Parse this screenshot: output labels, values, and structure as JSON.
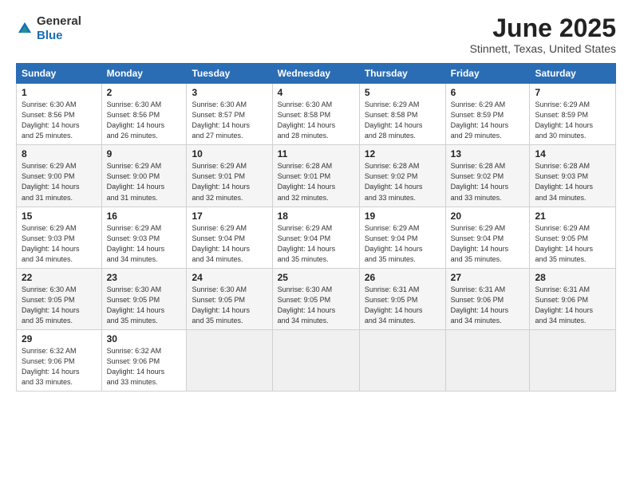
{
  "logo": {
    "general": "General",
    "blue": "Blue"
  },
  "title": "June 2025",
  "subtitle": "Stinnett, Texas, United States",
  "weekdays": [
    "Sunday",
    "Monday",
    "Tuesday",
    "Wednesday",
    "Thursday",
    "Friday",
    "Saturday"
  ],
  "weeks": [
    [
      {
        "day": "1",
        "sunrise": "6:30 AM",
        "sunset": "8:56 PM",
        "daylight": "14 hours and 25 minutes."
      },
      {
        "day": "2",
        "sunrise": "6:30 AM",
        "sunset": "8:56 PM",
        "daylight": "14 hours and 26 minutes."
      },
      {
        "day": "3",
        "sunrise": "6:30 AM",
        "sunset": "8:57 PM",
        "daylight": "14 hours and 27 minutes."
      },
      {
        "day": "4",
        "sunrise": "6:30 AM",
        "sunset": "8:58 PM",
        "daylight": "14 hours and 28 minutes."
      },
      {
        "day": "5",
        "sunrise": "6:29 AM",
        "sunset": "8:58 PM",
        "daylight": "14 hours and 28 minutes."
      },
      {
        "day": "6",
        "sunrise": "6:29 AM",
        "sunset": "8:59 PM",
        "daylight": "14 hours and 29 minutes."
      },
      {
        "day": "7",
        "sunrise": "6:29 AM",
        "sunset": "8:59 PM",
        "daylight": "14 hours and 30 minutes."
      }
    ],
    [
      {
        "day": "8",
        "sunrise": "6:29 AM",
        "sunset": "9:00 PM",
        "daylight": "14 hours and 31 minutes."
      },
      {
        "day": "9",
        "sunrise": "6:29 AM",
        "sunset": "9:00 PM",
        "daylight": "14 hours and 31 minutes."
      },
      {
        "day": "10",
        "sunrise": "6:29 AM",
        "sunset": "9:01 PM",
        "daylight": "14 hours and 32 minutes."
      },
      {
        "day": "11",
        "sunrise": "6:28 AM",
        "sunset": "9:01 PM",
        "daylight": "14 hours and 32 minutes."
      },
      {
        "day": "12",
        "sunrise": "6:28 AM",
        "sunset": "9:02 PM",
        "daylight": "14 hours and 33 minutes."
      },
      {
        "day": "13",
        "sunrise": "6:28 AM",
        "sunset": "9:02 PM",
        "daylight": "14 hours and 33 minutes."
      },
      {
        "day": "14",
        "sunrise": "6:28 AM",
        "sunset": "9:03 PM",
        "daylight": "14 hours and 34 minutes."
      }
    ],
    [
      {
        "day": "15",
        "sunrise": "6:29 AM",
        "sunset": "9:03 PM",
        "daylight": "14 hours and 34 minutes."
      },
      {
        "day": "16",
        "sunrise": "6:29 AM",
        "sunset": "9:03 PM",
        "daylight": "14 hours and 34 minutes."
      },
      {
        "day": "17",
        "sunrise": "6:29 AM",
        "sunset": "9:04 PM",
        "daylight": "14 hours and 34 minutes."
      },
      {
        "day": "18",
        "sunrise": "6:29 AM",
        "sunset": "9:04 PM",
        "daylight": "14 hours and 35 minutes."
      },
      {
        "day": "19",
        "sunrise": "6:29 AM",
        "sunset": "9:04 PM",
        "daylight": "14 hours and 35 minutes."
      },
      {
        "day": "20",
        "sunrise": "6:29 AM",
        "sunset": "9:04 PM",
        "daylight": "14 hours and 35 minutes."
      },
      {
        "day": "21",
        "sunrise": "6:29 AM",
        "sunset": "9:05 PM",
        "daylight": "14 hours and 35 minutes."
      }
    ],
    [
      {
        "day": "22",
        "sunrise": "6:30 AM",
        "sunset": "9:05 PM",
        "daylight": "14 hours and 35 minutes."
      },
      {
        "day": "23",
        "sunrise": "6:30 AM",
        "sunset": "9:05 PM",
        "daylight": "14 hours and 35 minutes."
      },
      {
        "day": "24",
        "sunrise": "6:30 AM",
        "sunset": "9:05 PM",
        "daylight": "14 hours and 35 minutes."
      },
      {
        "day": "25",
        "sunrise": "6:30 AM",
        "sunset": "9:05 PM",
        "daylight": "14 hours and 34 minutes."
      },
      {
        "day": "26",
        "sunrise": "6:31 AM",
        "sunset": "9:05 PM",
        "daylight": "14 hours and 34 minutes."
      },
      {
        "day": "27",
        "sunrise": "6:31 AM",
        "sunset": "9:06 PM",
        "daylight": "14 hours and 34 minutes."
      },
      {
        "day": "28",
        "sunrise": "6:31 AM",
        "sunset": "9:06 PM",
        "daylight": "14 hours and 34 minutes."
      }
    ],
    [
      {
        "day": "29",
        "sunrise": "6:32 AM",
        "sunset": "9:06 PM",
        "daylight": "14 hours and 33 minutes."
      },
      {
        "day": "30",
        "sunrise": "6:32 AM",
        "sunset": "9:06 PM",
        "daylight": "14 hours and 33 minutes."
      },
      null,
      null,
      null,
      null,
      null
    ]
  ]
}
